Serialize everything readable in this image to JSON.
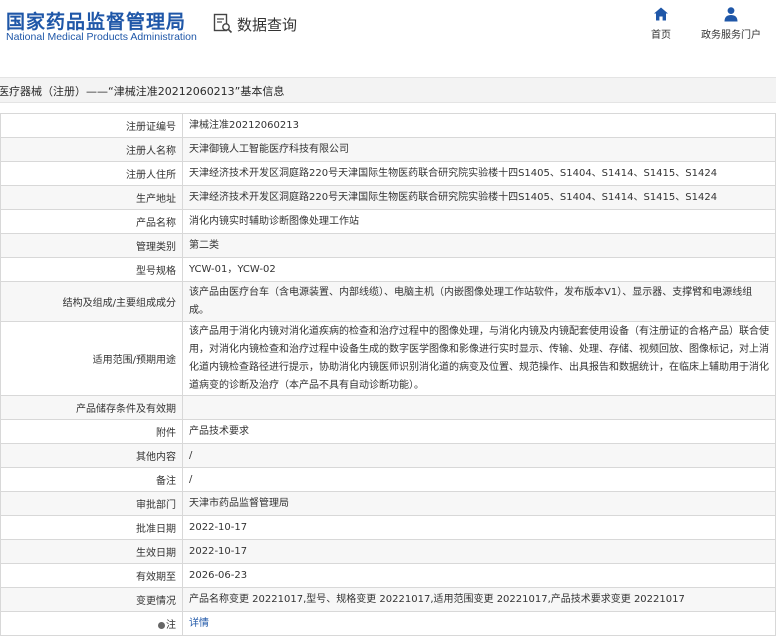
{
  "header": {
    "logo_cn": "国家药品监督管理局",
    "logo_en": "National Medical Products Administration",
    "query_label": "数据查询",
    "nav": [
      {
        "label": "首页",
        "icon": "home-icon"
      },
      {
        "label": "政务服务门户",
        "icon": "user-icon"
      }
    ]
  },
  "title": "医疗器械（注册）——“津械注准20212060213”基本信息",
  "rows": [
    {
      "key": "注册证编号",
      "value": "津械注准20212060213"
    },
    {
      "key": "注册人名称",
      "value": "天津御镜人工智能医疗科技有限公司"
    },
    {
      "key": "注册人住所",
      "value": "天津经济技术开发区洞庭路220号天津国际生物医药联合研究院实验楼十四S1405、S1404、S1414、S1415、S1424"
    },
    {
      "key": "生产地址",
      "value": "天津经济技术开发区洞庭路220号天津国际生物医药联合研究院实验楼十四S1405、S1404、S1414、S1415、S1424"
    },
    {
      "key": "产品名称",
      "value": "消化内镜实时辅助诊断图像处理工作站"
    },
    {
      "key": "管理类别",
      "value": "第二类"
    },
    {
      "key": "型号规格",
      "value": "YCW-01，YCW-02"
    },
    {
      "key": "结构及组成/主要组成成分",
      "value": "该产品由医疗台车（含电源装置、内部线缆）、电脑主机（内嵌图像处理工作站软件，发布版本V1）、显示器、支撑臂和电源线组成。"
    },
    {
      "key": "适用范围/预期用途",
      "value": "该产品用于消化内镜对消化道疾病的检查和治疗过程中的图像处理，与消化内镜及内镜配套使用设备（有注册证的合格产品）联合使用，对消化内镜检查和治疗过程中设备生成的数字医学图像和影像进行实时显示、传输、处理、存储、视频回放、图像标记，对上消化道内镜检查路径进行提示，协助消化内镜医师识别消化道的病变及位置、规范操作、出具报告和数据统计，在临床上辅助用于消化道病变的诊断及治疗（本产品不具有自动诊断功能）。"
    },
    {
      "key": "产品储存条件及有效期",
      "value": ""
    },
    {
      "key": "附件",
      "value": "产品技术要求"
    },
    {
      "key": "其他内容",
      "value": "/"
    },
    {
      "key": "备注",
      "value": "/"
    },
    {
      "key": "审批部门",
      "value": "天津市药品监督管理局"
    },
    {
      "key": "批准日期",
      "value": "2022-10-17"
    },
    {
      "key": "生效日期",
      "value": "2022-10-17"
    },
    {
      "key": "有效期至",
      "value": "2026-06-23"
    },
    {
      "key": "变更情况",
      "value": "产品名称变更 20221017,型号、规格变更 20221017,适用范围变更 20221017,产品技术要求变更 20221017"
    },
    {
      "key": "注",
      "value": "详情"
    }
  ],
  "colors": {
    "brand": "#1f57a8",
    "border": "#d8d8d8",
    "alt_row": "#f7f7f7"
  }
}
